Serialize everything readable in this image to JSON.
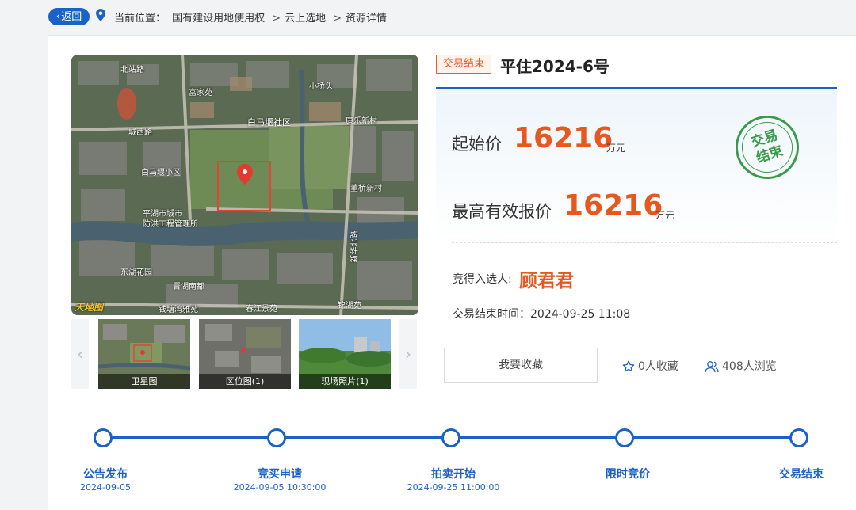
{
  "nav": {
    "back_label": "返回",
    "location_prefix": "当前位置：",
    "crumbs": [
      "国有建设用地使用权",
      "云上选地",
      "资源详情"
    ],
    "sep": ">"
  },
  "map": {
    "labels": [
      "北站路",
      "富家苑",
      "小桥头",
      "白马堰社区",
      "康乐新村",
      "城西路",
      "白马堰小区",
      "董桥新村",
      "平湖市城市",
      "防洪工程管理所",
      "新华北路",
      "东湖花园",
      "晋湖南都",
      "钱塘湾雅苑",
      "锦湖苑",
      "春江景苑"
    ],
    "watermark": "天地图"
  },
  "thumbs": [
    {
      "caption": "卫星图"
    },
    {
      "caption": "区位图(1)"
    },
    {
      "caption": "现场照片(1)"
    }
  ],
  "listing": {
    "status": "交易结束",
    "title": "平住2024-6号",
    "start_price_label": "起始价",
    "start_price": "16216",
    "start_price_unit": "万元",
    "max_price_label": "最高有效报价",
    "max_price": "16216",
    "max_price_unit": "万元",
    "stamp_text_1": "交易",
    "stamp_text_2": "结束",
    "winner_label": "竞得入选人:",
    "winner_name": "顾君君",
    "end_time_label": "交易结束时间：",
    "end_time": "2024-09-25 11:08"
  },
  "actions": {
    "favorite_label": "我要收藏",
    "favorites_count": "0",
    "favorites_suffix": "人收藏",
    "views_count": "408",
    "views_suffix": "人浏览"
  },
  "colors": {
    "brand_blue": "#1b62c8",
    "accent_orange": "#e8581e",
    "stamp_green": "#3a9a4b"
  },
  "timeline": [
    {
      "label": "公告发布",
      "date": "2024-09-05"
    },
    {
      "label": "竞买申请",
      "date": "2024-09-05 10:30:00"
    },
    {
      "label": "拍卖开始",
      "date": "2024-09-25 11:00:00"
    },
    {
      "label": "限时竞价",
      "date": ""
    },
    {
      "label": "交易结束",
      "date": ""
    }
  ]
}
